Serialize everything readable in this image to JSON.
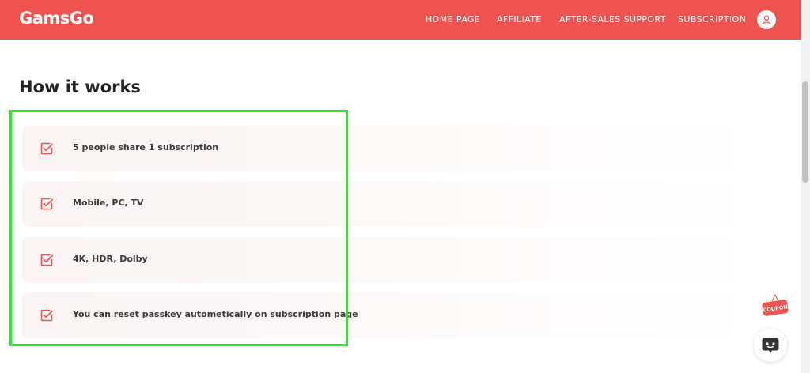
{
  "header": {
    "logo": "GamsGo",
    "nav": [
      "HOME PAGE",
      "AFFILIATE",
      "AFTER-SALES SUPPORT",
      "SUBSCRIPTION"
    ],
    "background_color": "#ef5350"
  },
  "section": {
    "title": "How it works",
    "features": [
      "5 people share 1 subscription",
      "Mobile, PC, TV",
      "4K, HDR, Dolby",
      "You can reset passkey autometically on subscription page"
    ]
  },
  "coupon": {
    "label": "COUPON"
  },
  "colors": {
    "accent": "#ef5350",
    "highlight": "#22ee22"
  }
}
